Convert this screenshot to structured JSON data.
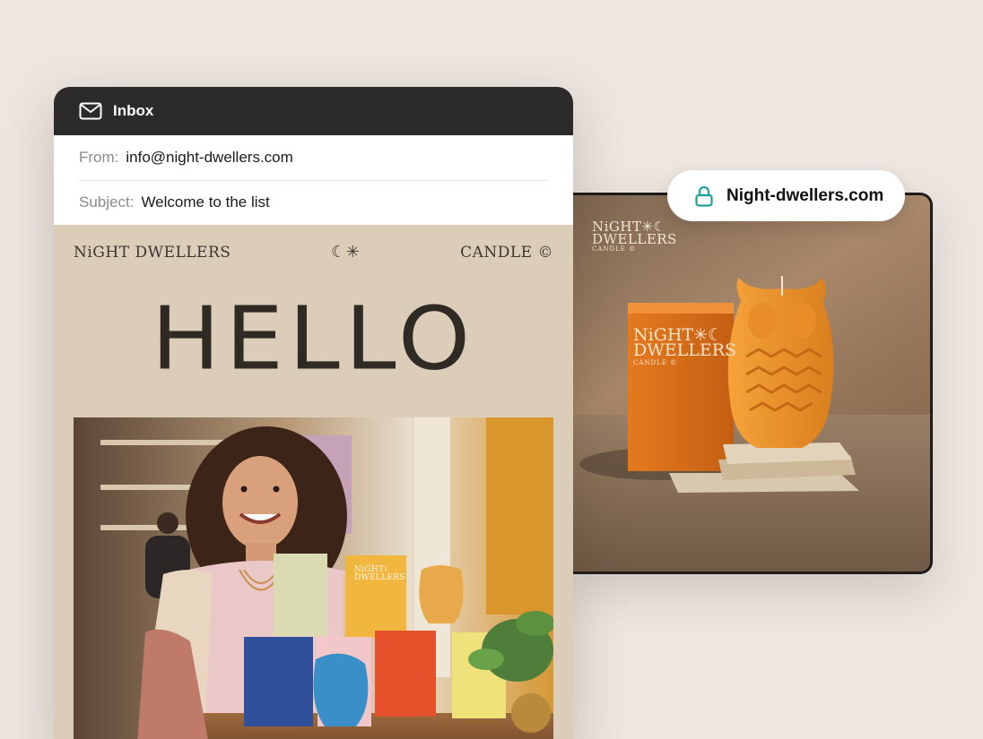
{
  "email": {
    "header_title": "Inbox",
    "from_label": "From:",
    "from_value": "info@night-dwellers.com",
    "subject_label": "Subject:",
    "subject_value": "Welcome to the list"
  },
  "newsletter": {
    "brand_left": "NiGHT DWELLERS",
    "brand_center": "☾✳",
    "brand_right": "CANDLE ©",
    "headline": "HELLO",
    "candle_box_label_line1": "NiGHT☾",
    "candle_box_label_line2": "DWELLERS"
  },
  "website": {
    "url": "Night-dwellers.com",
    "logo_line1": "NiGHT✳☾",
    "logo_line2": "DWELLERS",
    "logo_line3": "CANDLE ©",
    "box_line1": "NiGHT✳☾",
    "box_line2": "DWELLERS",
    "box_line3": "CANDLE ©"
  },
  "colors": {
    "page_bg": "#ede6e1",
    "inbox_header_bg": "#2c2a2a",
    "newsletter_bg": "#dccdb8",
    "lock_accent": "#1aa39a"
  },
  "icons": {
    "inbox": "envelope-icon",
    "url": "lock-icon"
  }
}
